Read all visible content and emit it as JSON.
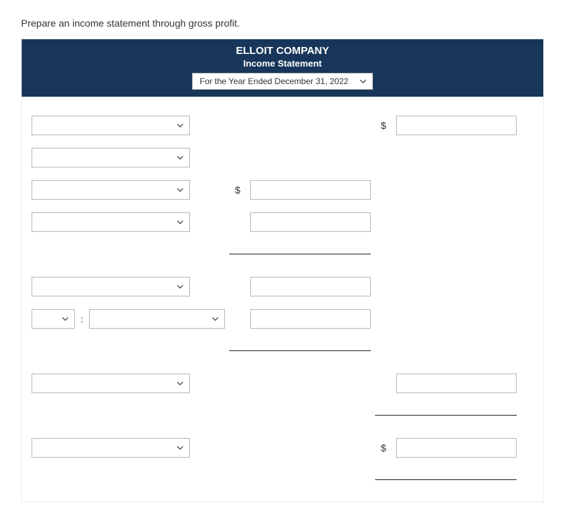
{
  "instruction": "Prepare an income statement through gross profit.",
  "header": {
    "company": "ELLOIT COMPANY",
    "statement": "Income Statement",
    "period": "For the Year Ended December 31, 2022"
  },
  "symbols": {
    "dollar": "$",
    "colon": ":"
  },
  "rows": [
    {
      "label": "",
      "mid_dollar": false,
      "mid_input": false,
      "right_dollar": true,
      "right_input": true
    },
    {
      "label": "",
      "mid_dollar": false,
      "mid_input": false,
      "right_dollar": false,
      "right_input": false
    },
    {
      "label": "",
      "mid_dollar": true,
      "mid_input": true,
      "right_dollar": false,
      "right_input": false
    },
    {
      "label": "",
      "mid_dollar": false,
      "mid_input": true,
      "right_dollar": false,
      "right_input": false,
      "underline_mid_after": true
    },
    {
      "label": "",
      "mid_dollar": false,
      "mid_input": true,
      "right_dollar": false,
      "right_input": false
    },
    {
      "split": true,
      "mini_label": "",
      "wide_label": "",
      "mid_dollar": false,
      "mid_input": true,
      "right_dollar": false,
      "right_input": false,
      "underline_mid_after": true
    },
    {
      "label": "",
      "mid_dollar": false,
      "mid_input": false,
      "right_dollar": false,
      "right_input": true,
      "underline_right_after": true
    },
    {
      "label": "",
      "mid_dollar": false,
      "mid_input": false,
      "right_dollar": true,
      "right_input": true,
      "underline_right_after": true
    }
  ]
}
